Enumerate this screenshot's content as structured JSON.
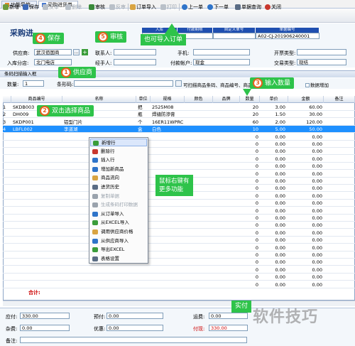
{
  "tabs": [
    {
      "label": "功能导航"
    },
    {
      "label": "采购进货单"
    }
  ],
  "toolbar": {
    "new": "新增",
    "save": "保存",
    "review": "反审",
    "delete": "删除",
    "audit": "审核",
    "unaudit": "反审",
    "import_order": "订单导入",
    "print": "打印",
    "prev": "上一单",
    "next": "下一单",
    "query": "单据查询",
    "close": "关闭"
  },
  "form": {
    "title": "采购进",
    "hdr_cols": [
      "入库",
      "付款期限",
      "自定义单号",
      "单据编号"
    ],
    "doc_no": "A02-CJ-201906240001",
    "supplier_label": "供应商:",
    "supplier_value": "武汉佰国商",
    "contact_label": "联系人:",
    "phone_label": "手机:",
    "open_type_label": "开票类型:",
    "warehouse_label": "入库分店:",
    "warehouse_value": "北门电店",
    "handler_label": "经手人:",
    "pay_account_label": "付款帐户:",
    "pay_account_value": "现金",
    "settle_label": "交易类型:",
    "settle_value": "现结"
  },
  "scan": {
    "section_label": "条码扫描输入框",
    "qty_label": "数量:",
    "qty_value": "1",
    "barcode_label": "条形码:",
    "hint": "可扫描商品条码、商品编号、商品名称和",
    "check_label": "数据增加"
  },
  "table": {
    "headers": [
      "商品编号",
      "名称",
      "单位",
      "规格",
      "颜色",
      "品牌",
      "数量",
      "单价",
      "金额",
      "备注"
    ],
    "rows": [
      {
        "idx": "1",
        "code": "SKDB003",
        "name": "",
        "unit": "把",
        "spec": "2525M08",
        "qty": "20",
        "price": "3.00",
        "amount": "60.00"
      },
      {
        "idx": "2",
        "code": "DH009",
        "name": "",
        "unit": "瓶",
        "spec": "焊缝防渗膏",
        "qty": "20",
        "price": "1.50",
        "amount": "30.00"
      },
      {
        "idx": "3",
        "code": "SKDP001",
        "name": "铝型门片",
        "unit": "个",
        "spec": "16ER11WPRC",
        "qty": "60",
        "price": "2.00",
        "amount": "120.00"
      },
      {
        "idx": "4",
        "code": "LBFL002",
        "name": "李道湖",
        "unit": "盒",
        "spec": "白色",
        "qty": "10",
        "price": "5.00",
        "amount": "50.00"
      }
    ],
    "empty_qty": "0",
    "empty_price": "0.00",
    "total_label": "合计:"
  },
  "context_menu": [
    {
      "label": "新增行",
      "enabled": true
    },
    {
      "label": "删除行",
      "enabled": true
    },
    {
      "label": "插入行",
      "enabled": true
    },
    {
      "label": "增加新商品",
      "enabled": true
    },
    {
      "label": "商品流向",
      "enabled": true
    },
    {
      "label": "进货历史",
      "enabled": true
    },
    {
      "label": "复制单据",
      "enabled": false
    },
    {
      "label": "生成条码打印数据",
      "enabled": false
    },
    {
      "label": "从订单导入",
      "enabled": true
    },
    {
      "label": "从EXCEL导入",
      "enabled": true
    },
    {
      "label": "调用供应商价格",
      "enabled": true
    },
    {
      "label": "从供应商导入",
      "enabled": true
    },
    {
      "label": "导出EXCEL",
      "enabled": true
    },
    {
      "label": "表格设置",
      "enabled": true
    }
  ],
  "footer": {
    "payable_label": "应付:",
    "payable_value": "330.00",
    "prepay_label": "预付:",
    "prepay_value": "0.00",
    "freight_label": "运费:",
    "freight_value": "0.00",
    "misc_label": "杂费:",
    "misc_value": "0.00",
    "discount_label": "优惠:",
    "discount_value": "0.00",
    "paid_label": "付现:",
    "paid_value": "330.00",
    "remark_label": "备注:"
  },
  "annotations": {
    "save": {
      "num": "4",
      "text": "保存"
    },
    "audit": {
      "num": "5",
      "text": "审核"
    },
    "import": "也可导入订单",
    "supplier": {
      "num": "1",
      "text": "供应商"
    },
    "choose": {
      "num": "2",
      "text": "双击选择商品"
    },
    "qty": {
      "num": "3",
      "text": "输入数量"
    },
    "rightclick": "鼠标右键有\n更多功能",
    "actual": "实付"
  },
  "watermark": "软件技巧",
  "colors": {
    "accent": "#1f4fb0",
    "selected_row": "#1e90ff",
    "callout": "#2ec34a",
    "badge": "#e8601c"
  }
}
